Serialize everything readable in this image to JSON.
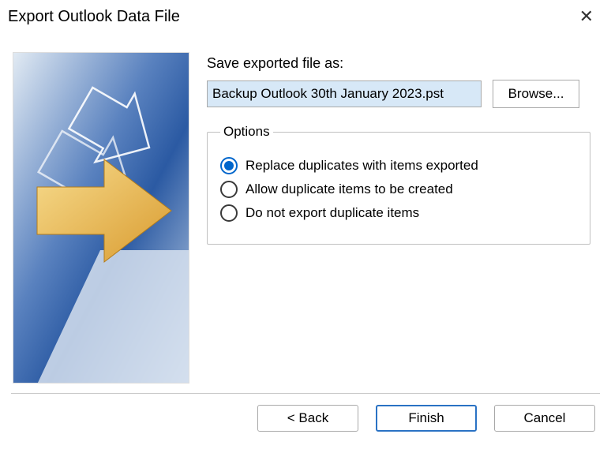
{
  "title": "Export Outlook Data File",
  "save_label": "Save exported file as:",
  "file_path": "Backup Outlook 30th January 2023.pst",
  "browse_label": "Browse...",
  "options": {
    "legend": "Options",
    "items": [
      {
        "label": "Replace duplicates with items exported",
        "checked": true
      },
      {
        "label": "Allow duplicate items to be created",
        "checked": false
      },
      {
        "label": "Do not export duplicate items",
        "checked": false
      }
    ]
  },
  "buttons": {
    "back": "< Back",
    "finish": "Finish",
    "cancel": "Cancel"
  }
}
